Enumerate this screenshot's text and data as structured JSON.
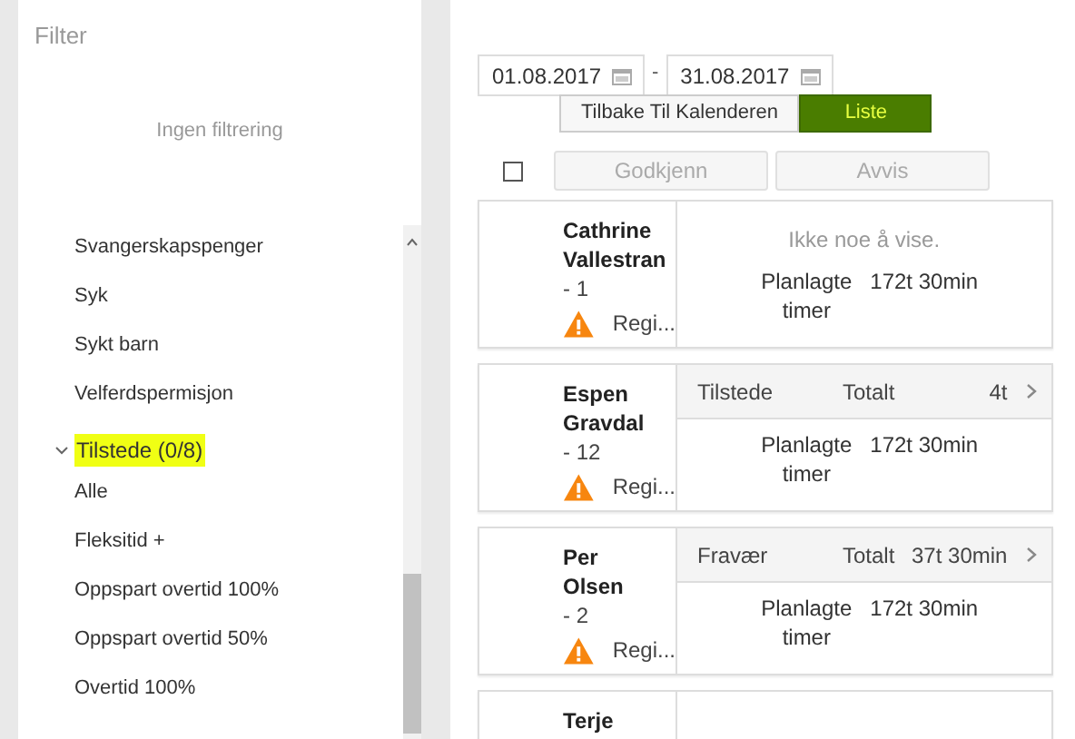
{
  "filter": {
    "title": "Filter",
    "empty_text": "Ingen filtrering"
  },
  "filter_list": [
    {
      "kind": "item",
      "label": "Svangerskapspenger"
    },
    {
      "kind": "item",
      "label": "Syk"
    },
    {
      "kind": "item",
      "label": "Sykt barn"
    },
    {
      "kind": "item",
      "label": "Velferdspermisjon"
    },
    {
      "kind": "group",
      "label": "Tilstede (0/8)",
      "expanded": true,
      "highlighted": true
    },
    {
      "kind": "item",
      "label": "Alle"
    },
    {
      "kind": "item",
      "label": "Fleksitid +"
    },
    {
      "kind": "item",
      "label": "Oppspart overtid 100%"
    },
    {
      "kind": "item",
      "label": "Oppspart overtid 50%"
    },
    {
      "kind": "item",
      "label": "Overtid 100%"
    }
  ],
  "date_from": "01.08.2017",
  "date_separator": "-",
  "date_to": "31.08.2017",
  "view_buttons": [
    {
      "label": "Tilbake Til Kalenderen",
      "selected": false
    },
    {
      "label": "Liste",
      "selected": true
    }
  ],
  "select_all": {
    "checked": false
  },
  "actions": [
    {
      "label": "Godkjenn",
      "disabled": true
    },
    {
      "label": "Avvis",
      "disabled": true
    }
  ],
  "employees": [
    {
      "kind": "empty",
      "name": "Cathrine Vallestran",
      "number": "- 1",
      "warning": "Regi...",
      "message": "Ikke noe å vise.",
      "planned_label": "Planlagte timer",
      "planned_value": "172t 30min"
    },
    {
      "kind": "summary",
      "name": "Espen Gravdal",
      "number": "- 12",
      "warning": "Regi...",
      "category": "Tilstede",
      "total_label": "Totalt",
      "total_value": "4t",
      "planned_label": "Planlagte timer",
      "planned_value": "172t 30min"
    },
    {
      "kind": "summary",
      "name": "Per Olsen",
      "number": "- 2",
      "warning": "Regi...",
      "category": "Fravær",
      "total_label": "Totalt",
      "total_value": "37t 30min",
      "planned_label": "Planlagte timer",
      "planned_value": "172t 30min"
    },
    {
      "kind": "partial",
      "name": "Terje"
    }
  ]
}
